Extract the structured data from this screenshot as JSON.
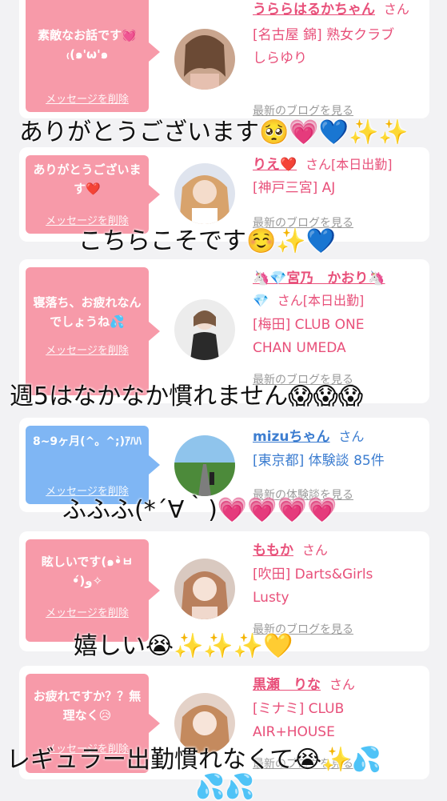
{
  "cards": [
    {
      "bubble": "素敵なお話です💓₍(๑'ω'๑",
      "delete": "メッセージを削除",
      "name": "うららはるかちゃん",
      "san": "さん",
      "shop_line1": "[名古屋 錦] 熟女クラブ",
      "shop_line2": "しらゆり",
      "blog": "最新のブログを見る"
    },
    {
      "bubble": "ありがとうございます❤️",
      "delete": "メッセージを削除",
      "name": "りえ❤️",
      "san": "さん[本日出勤]",
      "shop_line1": "[神戸三宮] AJ",
      "shop_line2": "",
      "blog": "最新のブログを見る"
    },
    {
      "bubble": "寝落ち、お疲れなんでしょうね💦",
      "delete": "メッセージを削除",
      "name": "🦄💎宮乃　かおり🦄",
      "name_cont": "💎",
      "san": "さん[本日出勤]",
      "shop_line1": "[梅田] CLUB ONE",
      "shop_line2": "CHAN UMEDA",
      "blog": "最新のブログを見る"
    },
    {
      "bubble": "8~9ヶ月(^。^;)ｱﾊﾊ",
      "delete": "メッセージを削除",
      "name": "mizuちゃん",
      "san": "さん",
      "shop_line1": "[東京都] 体験談 85件",
      "shop_line2": "",
      "blog": "最新の体験談を見る"
    },
    {
      "bubble": "眩しいです(๑•̀ㅂ•́)و✧",
      "delete": "メッセージを削除",
      "name": "ももか",
      "san": "さん",
      "shop_line1": "[吹田] Darts&Girls",
      "shop_line2": "Lusty",
      "blog": "最新のブログを見る"
    },
    {
      "bubble": "お疲れですか？？無理なく😥",
      "delete": "メッセージを削除",
      "name": "黒瀬　りな",
      "san": "さん",
      "shop_line1": "[ミナミ] CLUB",
      "shop_line2": "AIR+HOUSE",
      "blog": "最新のブログを見る"
    }
  ],
  "captions": [
    "ありがとうございます🥺💗💙✨✨",
    "こちらこそです☺️✨💙",
    "週5はなかなか慣れません😱😱😱",
    "ふふふ(*´∀｀)💗💗💗💗",
    "嬉しい😭✨✨✨💛",
    "レギュラー出勤慣れなくて😭✨💦",
    "💦💦"
  ],
  "colors": {
    "bubble_pink": "#f79aa9",
    "bubble_blue": "#7fb6f4",
    "name_pink": "#e8507a",
    "name_blue": "#3c7dd0"
  }
}
